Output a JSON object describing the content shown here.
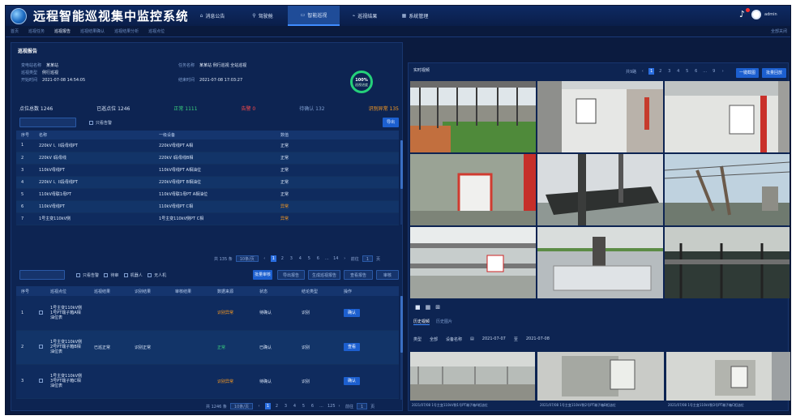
{
  "header": {
    "title": "远程智能巡视集中监控系统",
    "nav": [
      {
        "label": "消息公告",
        "icon": "home-icon"
      },
      {
        "label": "驾驶舱",
        "icon": "search-icon"
      },
      {
        "label": "智能巡视",
        "icon": "monitor-icon"
      },
      {
        "label": "巡视结果",
        "icon": "chart-icon"
      },
      {
        "label": "系统管理",
        "icon": "grid-icon"
      }
    ],
    "user": "admin"
  },
  "tabs": {
    "items": [
      "首页",
      "巡视任务",
      "巡视报告",
      "巡视结果确认",
      "巡视结果分析",
      "巡视点位"
    ],
    "more": "全部关闭"
  },
  "left": {
    "section_title": "巡视报告",
    "info": {
      "station_label": "变电站名称",
      "station_value": "某某站",
      "type_label": "巡视类型",
      "type_value": "例行巡视",
      "task_label": "任务名称",
      "task_value": "某某站 例行巡视 全站巡视",
      "start_label": "开始时间",
      "start_value": "2021-07-08 14:54:05",
      "end_label": "结束时间",
      "end_value": "2021-07-08 17:03:27"
    },
    "progress": {
      "percent": "100%",
      "label": "巡视进度",
      "value": 1.0
    },
    "stats": [
      {
        "text": "点位总数 1246",
        "color": "#dbe6f8"
      },
      {
        "text": "已巡点位 1246",
        "color": "#dbe6f8"
      },
      {
        "text": "正常 1111",
        "color": "#3ad27e"
      },
      {
        "text": "告警 0",
        "color": "#ff4a4a"
      },
      {
        "text": "待确认 132",
        "color": "#7f9ed0"
      },
      {
        "text": "识别异常 135",
        "color": "#ff9d1f"
      }
    ],
    "table1_filter": "只看告警",
    "table1_export": "导出",
    "table1": {
      "headers": [
        "序号",
        "名称",
        "一级设备",
        "数值"
      ],
      "rows": [
        [
          "1",
          "220kV I、II段母线PT",
          "220kV母线PT A相",
          "正常"
        ],
        [
          "2",
          "220kV I段母线",
          "220kV I段母线B相",
          "正常"
        ],
        [
          "3",
          "110kV母线PT",
          "110kV母线PT A相油位",
          "正常"
        ],
        [
          "4",
          "220kV I、II段母线PT",
          "220kV母线PT B相油位",
          "正常"
        ],
        [
          "5",
          "110kV母联1母PT",
          "110kV母联1母PT A相油位",
          "正常"
        ],
        [
          "6",
          "110kV母线PT",
          "110kV母线PT C相",
          "异常"
        ],
        [
          "7",
          "1号主变110kV侧",
          "1号主变110kV侧PT C相",
          "异常"
        ]
      ]
    },
    "pager1": {
      "total": "共 135 条",
      "size": "10条/页",
      "pages": [
        "1",
        "2",
        "3",
        "4",
        "5",
        "6",
        "...",
        "14"
      ],
      "jump": "前往",
      "page": "1",
      "unit": "页"
    },
    "table2_filters": [
      "只看告警",
      "待审",
      "机器人",
      "无人机"
    ],
    "table2_buttons": [
      "批量审核",
      "导出报告",
      "生成巡视报告",
      "查看报告",
      "审核"
    ],
    "table2": {
      "headers": [
        "序号",
        "",
        "巡视点位",
        "巡视结果",
        "识别结果",
        "审核结果",
        "数据来源",
        "状态",
        "结论类型",
        "操作"
      ],
      "rows": [
        {
          "no": "1",
          "point": "1号主变110kV侧1号PT端子箱A相油位表",
          "result": "",
          "identify": "",
          "review": "",
          "source": "识别异常",
          "status": "待确认",
          "type": "识别",
          "op": "确认"
        },
        {
          "no": "2",
          "point": "1号主变110kV侧2号PT端子箱B相油位表",
          "result": "已巡正常",
          "identify": "识别正常",
          "review": "",
          "source": "正常",
          "status": "已确认",
          "type": "识别",
          "op": "查看"
        },
        {
          "no": "3",
          "point": "1号主变110kV侧3号PT端子箱C相油位表",
          "result": "",
          "identify": "",
          "review": "",
          "source": "识别异常",
          "status": "待确认",
          "type": "识别",
          "op": "确认"
        }
      ]
    },
    "pager2": {
      "total": "共 1246 条",
      "size": "10条/页",
      "pages": [
        "1",
        "2",
        "3",
        "4",
        "5",
        "6",
        "...",
        "125"
      ],
      "jump": "前往",
      "page": "1",
      "unit": "页"
    }
  },
  "right": {
    "title": "实时视频",
    "pager": {
      "label": "共9路",
      "pages": [
        "1",
        "2",
        "3",
        "4",
        "5",
        "6",
        "...",
        "9"
      ]
    },
    "btn1": "一键截图",
    "btn2": "批量回放",
    "view_icons": [
      "grid-1-icon",
      "grid-4-icon",
      "grid-9-icon"
    ],
    "sub_tabs": [
      "历史视频",
      "历史图片"
    ],
    "filter": {
      "type_label": "类型",
      "type_value": "全部",
      "device_label": "设备名称",
      "date_label": "日期",
      "start": "2021-07-07",
      "to": "至",
      "end": "2021-07-08"
    },
    "captions": [
      "2021/07/08  1号主变110kV侧1号PT端子箱A相油位",
      "2021/07/08  1号主变110kV侧2号PT端子箱B相油位",
      "2021/07/08  1号主变110kV侧3号PT端子箱C相油位"
    ]
  },
  "colors": {
    "bg": "#0b1b3f",
    "accent": "#1c5fcf",
    "ok": "#3ad27e",
    "warn": "#ff9d1f",
    "alarm": "#ff4a4a"
  }
}
